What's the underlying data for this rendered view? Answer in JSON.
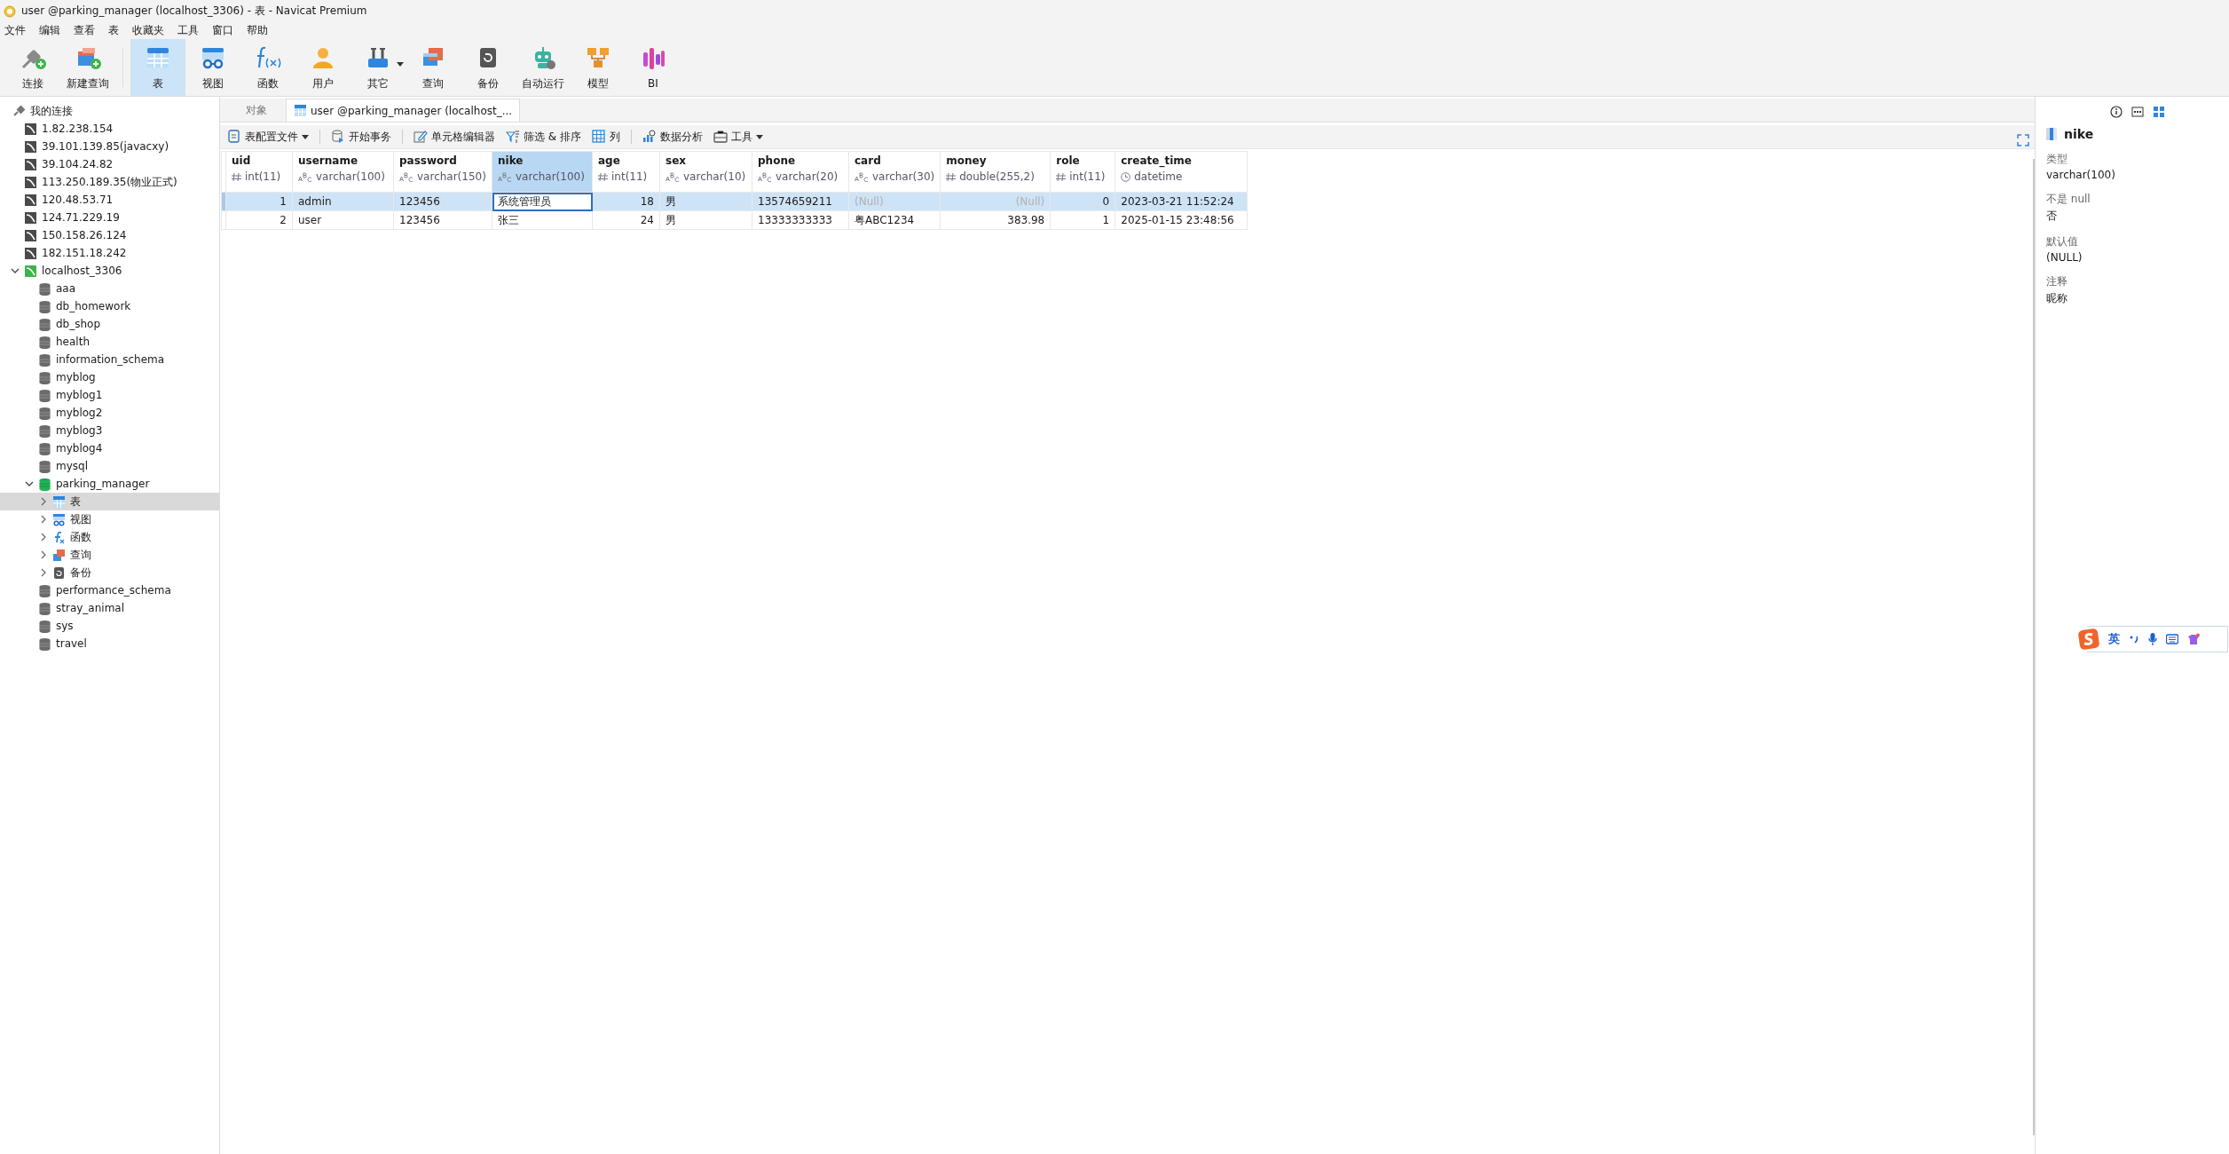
{
  "window": {
    "title": "user @parking_manager (localhost_3306) - 表 - Navicat Premium"
  },
  "menu": [
    "文件",
    "编辑",
    "查看",
    "表",
    "收藏夹",
    "工具",
    "窗口",
    "帮助"
  ],
  "toolbar": [
    {
      "label": "连接",
      "kind": "connect",
      "selected": false,
      "dropdown": false
    },
    {
      "label": "新建查询",
      "kind": "newquery",
      "selected": false,
      "dropdown": false
    },
    {
      "label": "表",
      "kind": "table",
      "selected": true,
      "dropdown": false
    },
    {
      "label": "视图",
      "kind": "view",
      "selected": false,
      "dropdown": false
    },
    {
      "label": "函数",
      "kind": "function",
      "selected": false,
      "dropdown": false
    },
    {
      "label": "用户",
      "kind": "user",
      "selected": false,
      "dropdown": false
    },
    {
      "label": "其它",
      "kind": "other",
      "selected": false,
      "dropdown": true
    },
    {
      "label": "查询",
      "kind": "query",
      "selected": false,
      "dropdown": false
    },
    {
      "label": "备份",
      "kind": "backup",
      "selected": false,
      "dropdown": false
    },
    {
      "label": "自动运行",
      "kind": "robot",
      "selected": false,
      "dropdown": false
    },
    {
      "label": "模型",
      "kind": "model",
      "selected": false,
      "dropdown": false
    },
    {
      "label": "BI",
      "kind": "bi",
      "selected": false,
      "dropdown": false
    }
  ],
  "sidebar": {
    "tree": [
      {
        "label": "我的连接",
        "kind": "group",
        "selected": false,
        "children": [
          {
            "label": "1.82.238.154",
            "kind": "connection",
            "selected": false
          },
          {
            "label": "39.101.139.85(javacxy)",
            "kind": "connection",
            "selected": false
          },
          {
            "label": "39.104.24.82",
            "kind": "connection",
            "selected": false
          },
          {
            "label": "113.250.189.35(物业正式)",
            "kind": "connection",
            "selected": false
          },
          {
            "label": "120.48.53.71",
            "kind": "connection",
            "selected": false
          },
          {
            "label": "124.71.229.19",
            "kind": "connection",
            "selected": false
          },
          {
            "label": "150.158.26.124",
            "kind": "connection",
            "selected": false
          },
          {
            "label": "182.151.18.242",
            "kind": "connection",
            "selected": false
          },
          {
            "label": "localhost_3306",
            "kind": "connection_open",
            "selected": false,
            "expanded": true,
            "children": [
              {
                "label": "aaa",
                "kind": "database",
                "selected": false
              },
              {
                "label": "db_homework",
                "kind": "database",
                "selected": false
              },
              {
                "label": "db_shop",
                "kind": "database",
                "selected": false
              },
              {
                "label": "health",
                "kind": "database",
                "selected": false
              },
              {
                "label": "information_schema",
                "kind": "database",
                "selected": false
              },
              {
                "label": "myblog",
                "kind": "database",
                "selected": false
              },
              {
                "label": "myblog1",
                "kind": "database",
                "selected": false
              },
              {
                "label": "myblog2",
                "kind": "database",
                "selected": false
              },
              {
                "label": "myblog3",
                "kind": "database",
                "selected": false
              },
              {
                "label": "myblog4",
                "kind": "database",
                "selected": false
              },
              {
                "label": "mysql",
                "kind": "database",
                "selected": false
              },
              {
                "label": "parking_manager",
                "kind": "database_open",
                "selected": false,
                "expanded": true,
                "children": [
                  {
                    "label": "表",
                    "kind": "table",
                    "selected": true,
                    "expanded": false
                  },
                  {
                    "label": "视图",
                    "kind": "view",
                    "selected": false,
                    "expanded": false
                  },
                  {
                    "label": "函数",
                    "kind": "function",
                    "selected": false,
                    "expanded": false
                  },
                  {
                    "label": "查询",
                    "kind": "query",
                    "selected": false,
                    "expanded": false
                  },
                  {
                    "label": "备份",
                    "kind": "backup",
                    "selected": false,
                    "expanded": false
                  }
                ]
              },
              {
                "label": "performance_schema",
                "kind": "database",
                "selected": false
              },
              {
                "label": "stray_animal",
                "kind": "database",
                "selected": false
              },
              {
                "label": "sys",
                "kind": "database",
                "selected": false
              },
              {
                "label": "travel",
                "kind": "database",
                "selected": false
              }
            ]
          }
        ]
      }
    ]
  },
  "tabs": [
    {
      "label": "对象",
      "kind": "plain",
      "selected": false
    },
    {
      "label": "user @parking_manager (localhost_...",
      "kind": "table",
      "selected": true
    }
  ],
  "subtoolbar": [
    {
      "label": "表配置文件",
      "kind": "profile",
      "dropdown": true
    },
    {
      "label": "开始事务",
      "kind": "transaction",
      "dropdown": false
    },
    {
      "label": "单元格编辑器",
      "kind": "edit",
      "dropdown": false
    },
    {
      "label": "筛选 & 排序",
      "kind": "filter",
      "dropdown": false
    },
    {
      "label": "列",
      "kind": "columns",
      "dropdown": false
    },
    {
      "label": "数据分析",
      "kind": "chart",
      "dropdown": false
    },
    {
      "label": "工具",
      "kind": "tools",
      "dropdown": true
    }
  ],
  "table": {
    "columns": [
      {
        "name": "uid",
        "type": "int(11)",
        "kind": "number",
        "selected": false
      },
      {
        "name": "username",
        "type": "varchar(100)",
        "kind": "text",
        "selected": false
      },
      {
        "name": "password",
        "type": "varchar(150)",
        "kind": "text",
        "selected": false
      },
      {
        "name": "nike",
        "type": "varchar(100)",
        "kind": "text",
        "selected": true
      },
      {
        "name": "age",
        "type": "int(11)",
        "kind": "number",
        "selected": false
      },
      {
        "name": "sex",
        "type": "varchar(10)",
        "kind": "text",
        "selected": false
      },
      {
        "name": "phone",
        "type": "varchar(20)",
        "kind": "text",
        "selected": false
      },
      {
        "name": "card",
        "type": "varchar(30)",
        "kind": "text",
        "selected": false
      },
      {
        "name": "money",
        "type": "double(255,2)",
        "kind": "number",
        "selected": false
      },
      {
        "name": "role",
        "type": "int(11)",
        "kind": "number",
        "selected": false
      },
      {
        "name": "create_time",
        "type": "datetime",
        "kind": "datetime",
        "selected": false
      }
    ],
    "rows": [
      {
        "selected": true,
        "cells": [
          {
            "value": "1",
            "null": false,
            "editing": false
          },
          {
            "value": "admin",
            "null": false,
            "editing": false
          },
          {
            "value": "123456",
            "null": false,
            "editing": false
          },
          {
            "value": "系统管理员",
            "null": false,
            "editing": true
          },
          {
            "value": "18",
            "null": false,
            "editing": false
          },
          {
            "value": "男",
            "null": false,
            "editing": false
          },
          {
            "value": "13574659211",
            "null": false,
            "editing": false
          },
          {
            "value": "(Null)",
            "null": true,
            "editing": false
          },
          {
            "value": "(Null)",
            "null": true,
            "editing": false
          },
          {
            "value": "0",
            "null": false,
            "editing": false
          },
          {
            "value": "2023-03-21 11:52:24",
            "null": false,
            "editing": false
          }
        ]
      },
      {
        "selected": false,
        "cells": [
          {
            "value": "2",
            "null": false,
            "editing": false
          },
          {
            "value": "user",
            "null": false,
            "editing": false
          },
          {
            "value": "123456",
            "null": false,
            "editing": false
          },
          {
            "value": "张三",
            "null": false,
            "editing": false
          },
          {
            "value": "24",
            "null": false,
            "editing": false
          },
          {
            "value": "男",
            "null": false,
            "editing": false
          },
          {
            "value": "13333333333",
            "null": false,
            "editing": false
          },
          {
            "value": "粤ABC1234",
            "null": false,
            "editing": false
          },
          {
            "value": "383.98",
            "null": false,
            "editing": false
          },
          {
            "value": "1",
            "null": false,
            "editing": false
          },
          {
            "value": "2025-01-15 23:48:56",
            "null": false,
            "editing": false
          }
        ]
      }
    ]
  },
  "inspector": {
    "views": [
      {
        "kind": "info",
        "selected": false
      },
      {
        "kind": "ddl",
        "selected": false
      },
      {
        "kind": "fields",
        "selected": true
      }
    ],
    "field": "nike",
    "properties": [
      {
        "label": "类型",
        "value": "varchar(100)"
      },
      {
        "label": "不是 null",
        "value": "否"
      },
      {
        "label": "默认值",
        "value": "(NULL)"
      },
      {
        "label": "注释",
        "value": "昵称"
      }
    ]
  },
  "ime_bar": {
    "language": "英"
  }
}
